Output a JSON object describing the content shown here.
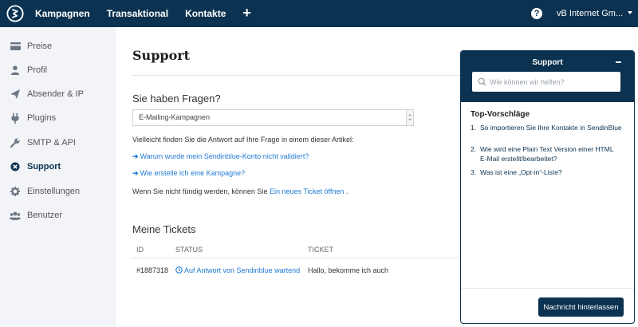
{
  "topbar": {
    "nav": [
      "Kampagnen",
      "Transaktional",
      "Kontakte"
    ],
    "plus": "+",
    "help": "?",
    "account": "vB Internet Gm..."
  },
  "sidebar": {
    "items": [
      {
        "label": "Preise",
        "icon": "price-tag-icon"
      },
      {
        "label": "Profil",
        "icon": "user-icon"
      },
      {
        "label": "Absender & IP",
        "icon": "paper-plane-icon"
      },
      {
        "label": "Plugins",
        "icon": "plug-icon"
      },
      {
        "label": "SMTP & API",
        "icon": "wrench-icon"
      },
      {
        "label": "Support",
        "icon": "support-icon",
        "active": true
      },
      {
        "label": "Einstellungen",
        "icon": "gear-icon"
      },
      {
        "label": "Benutzer",
        "icon": "users-icon"
      }
    ]
  },
  "main": {
    "title": "Support",
    "faq_heading": "Sie haben Fragen?",
    "category_select": "E-Mailing-Kampagnen",
    "hint": "Vielleicht finden Sie die Antwort auf Ihre Frage in einem dieser Artikel:",
    "articles": [
      "Warum wurde mein Sendinblue-Konto nicht validiert?",
      "Wie erstelle ich eine Kampagne?"
    ],
    "not_found_prefix": "Wenn Sie nicht fündig werden, können Sie",
    "not_found_link": "Ein neues Ticket öffnen",
    "not_found_suffix": ".",
    "tickets_heading": "Meine Tickets",
    "ticket_columns": [
      "ID",
      "STATUS",
      "TICKET"
    ],
    "tickets": [
      {
        "id": "#1887318",
        "status": "Auf Antwort von Sendinblue wartend",
        "ticket": "Hallo, bekomme ich auch"
      }
    ]
  },
  "widget": {
    "title": "Support",
    "minimize": "−",
    "search_placeholder": "Wie können wir helfen?",
    "suggestions_title": "Top-Vorschläge",
    "suggestions": [
      "So importieren Sie Ihre Kontakte in SendinBlue",
      "Wie wird eine Plain Text Version einer HTML E-Mail erstellt/bearbeitet?",
      "Was ist eine „Opt-in“-Liste?"
    ],
    "button": "Nachricht hinterlassen"
  },
  "colors": {
    "brand": "#0b3250",
    "link": "#1f7ad2",
    "sidebar_bg": "#f2f4f7"
  }
}
